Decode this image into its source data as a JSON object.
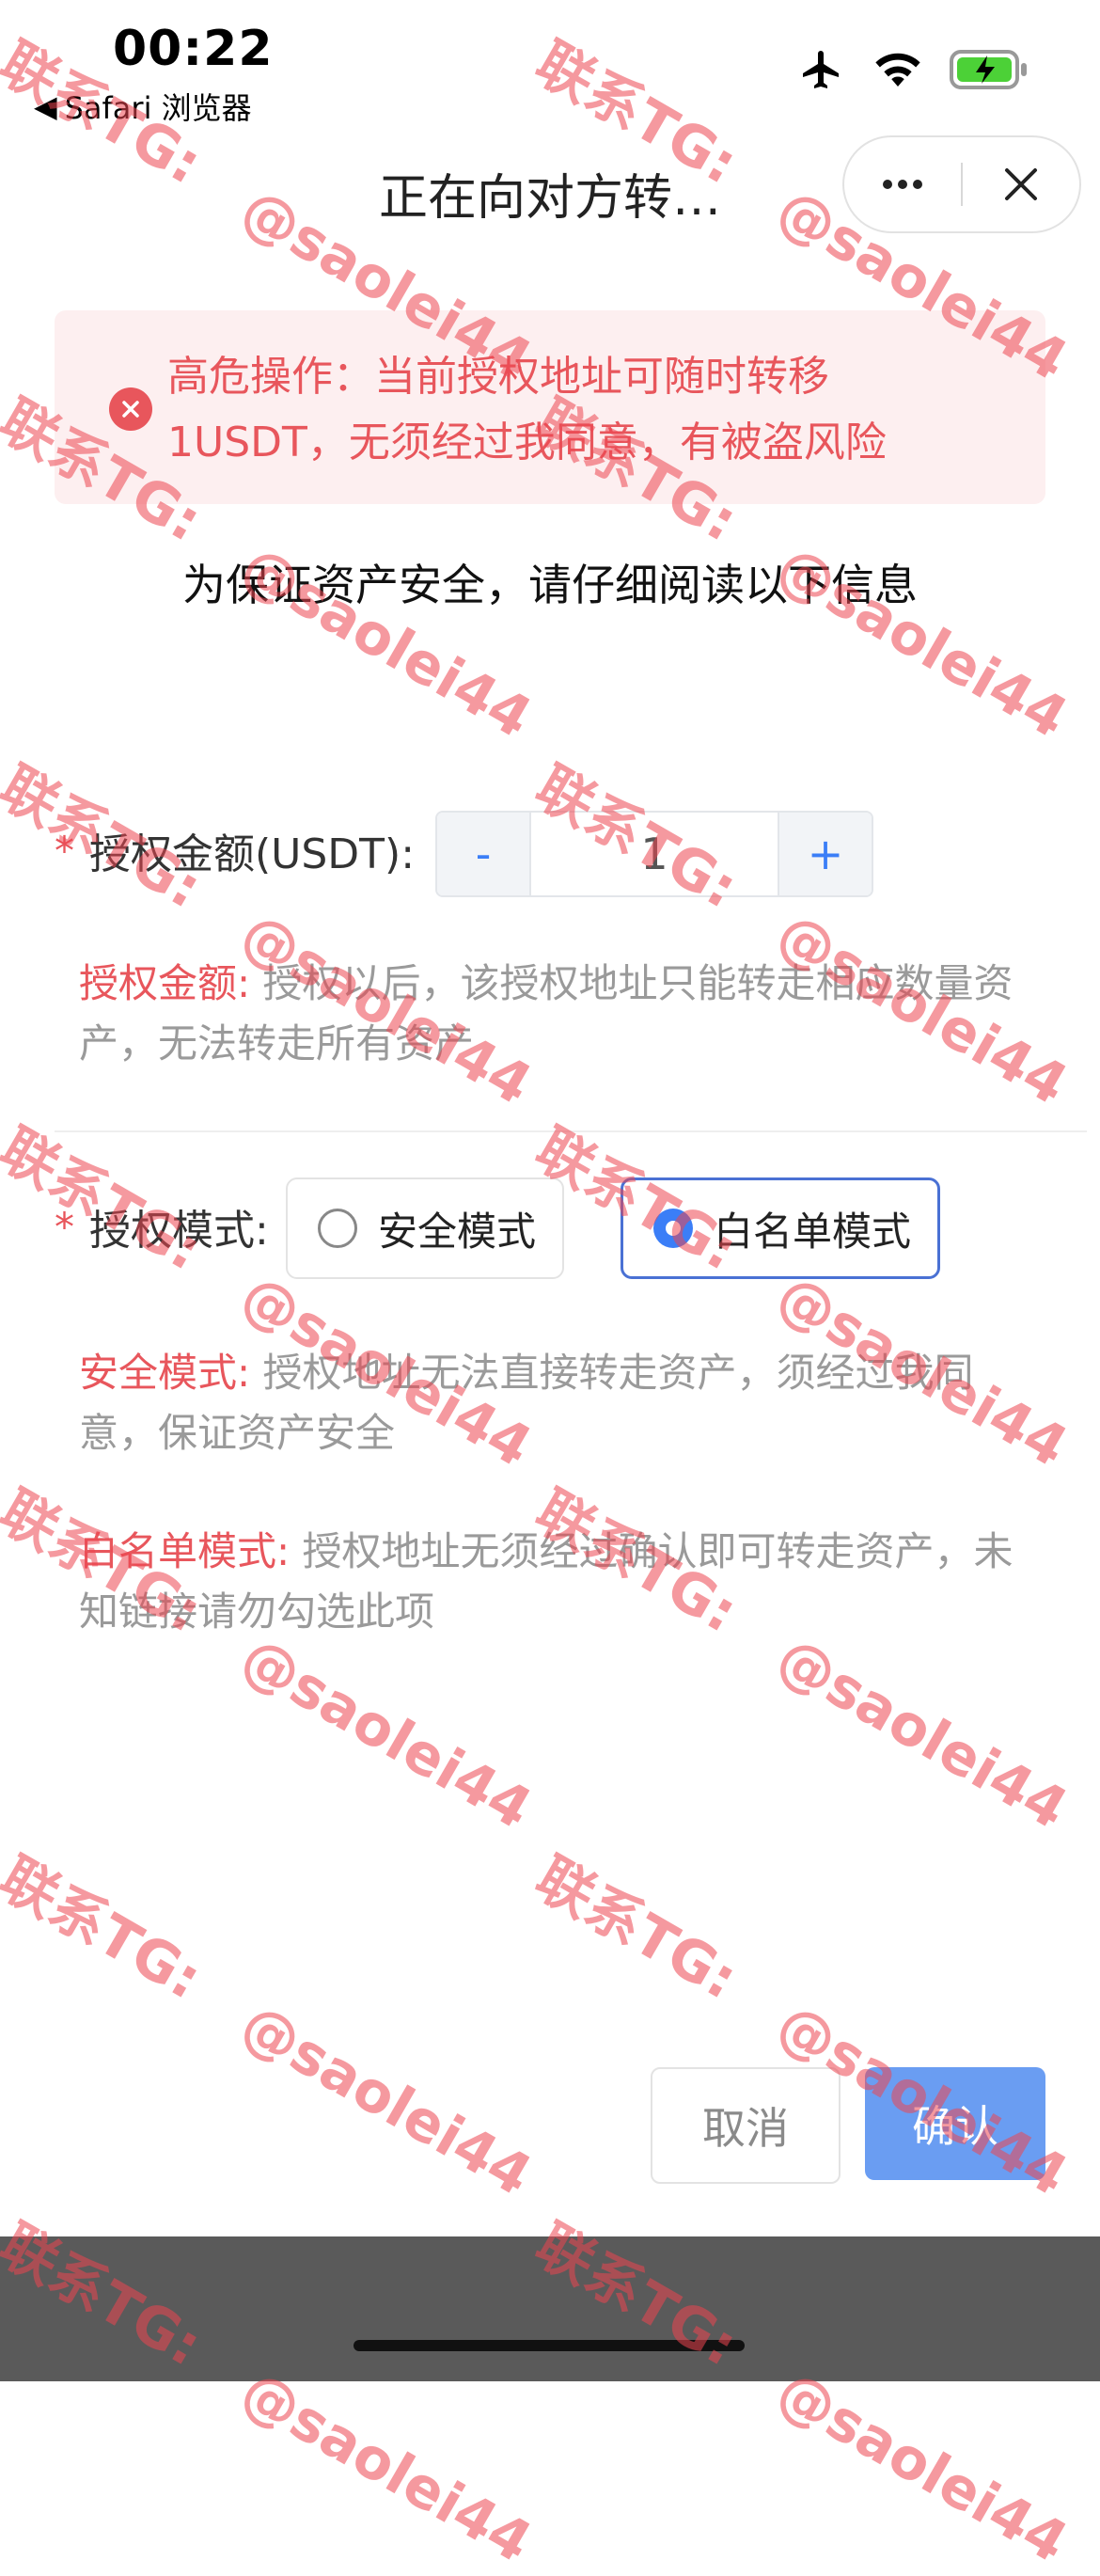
{
  "status_bar": {
    "time": "00:22",
    "back_app": "Safari 浏览器"
  },
  "nav": {
    "title": "正在向对方转…"
  },
  "alert": {
    "text": "高危操作：当前授权地址可随时转移1USDT，无须经过我同意，有被盗风险"
  },
  "intro": "为保证资产安全，请仔细阅读以下信息",
  "amount": {
    "required_mark": "*",
    "label": "授权金额(USDT):",
    "minus": "-",
    "value": "1",
    "plus": "+",
    "note_highlight": "授权金额:",
    "note_text": " 授权以后，该授权地址只能转走相应数量资产，无法转走所有资产"
  },
  "mode": {
    "required_mark": "*",
    "label": "授权模式:",
    "options": [
      {
        "label": "安全模式",
        "selected": false
      },
      {
        "label": "白名单模式",
        "selected": true
      }
    ],
    "safe_note_highlight": "安全模式:",
    "safe_note_text": " 授权地址无法直接转走资产，须经过我同意，保证资产安全",
    "white_note_highlight": "白名单模式:",
    "white_note_text": " 授权地址无须经过确认即可转走资产，未知链接请勿勾选此项"
  },
  "buttons": {
    "cancel": "取消",
    "confirm": "确认"
  },
  "watermark": {
    "line1": "联系TG:",
    "line2": "@saolei44"
  },
  "colors": {
    "accent": "#3b7ef7",
    "danger": "#e8565c",
    "confirm": "#6a9df2"
  },
  "icons": [
    "back-arrow-icon",
    "airplane-icon",
    "wifi-icon",
    "battery-charging-icon",
    "more-icon",
    "close-icon",
    "error-icon"
  ]
}
